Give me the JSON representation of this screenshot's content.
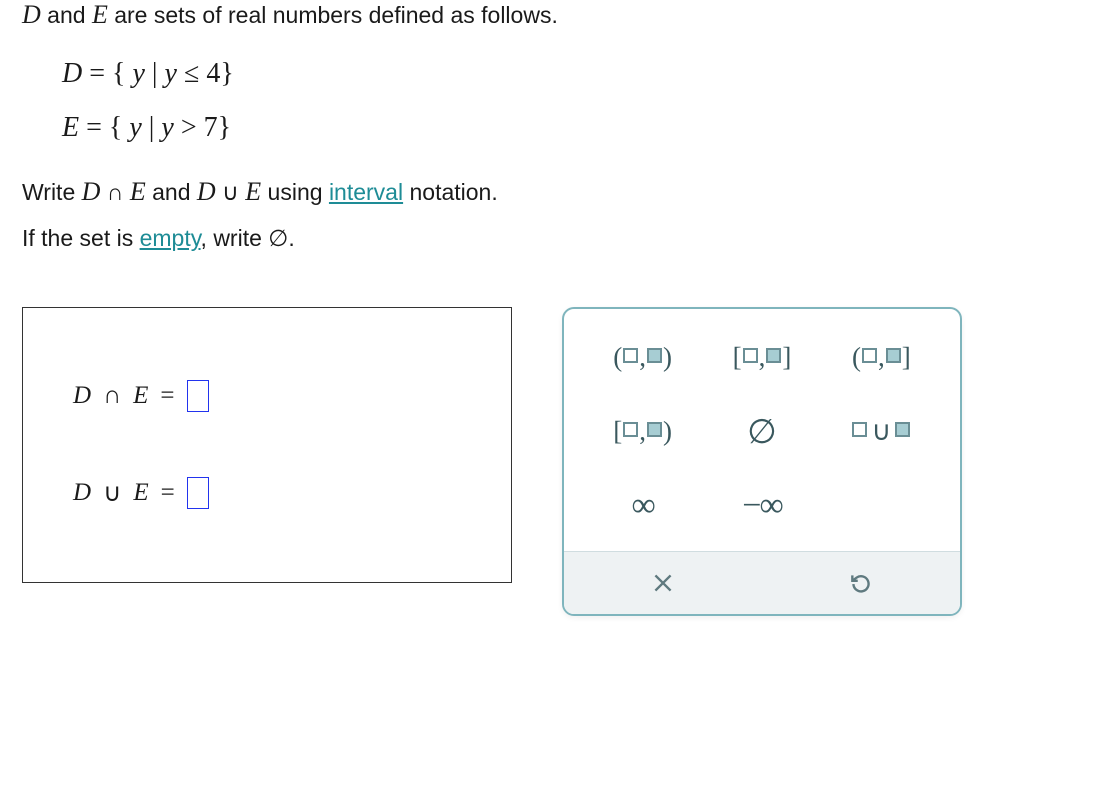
{
  "question": {
    "intro_pre": "D",
    "intro_mid": " and ",
    "intro_var2": "E",
    "intro_post": " are sets of real numbers defined as follows.",
    "defD": "D = { y | y ≤ 4 }",
    "defE": "E = { y | y > 7 }",
    "instr1_pre": "Write ",
    "instr1_cap": "D ∩ E",
    "instr1_mid": " and ",
    "instr1_cup": "D ∪ E",
    "instr1_post": " using ",
    "interval_link": "interval",
    "instr1_end": " notation.",
    "instr2_pre": "If the set is ",
    "empty_link": "empty",
    "instr2_mid": ", write ",
    "emptyset": "∅",
    "instr2_end": "."
  },
  "answers": {
    "row1_var1": "D",
    "row1_op": "∩",
    "row1_var2": "E",
    "row1_eq": "=",
    "row2_var1": "D",
    "row2_op": "∪",
    "row2_var2": "E",
    "row2_eq": "="
  },
  "pallette": {
    "open_open_l": "(",
    "open_open_r": ")",
    "closed_closed_l": "[",
    "closed_closed_r": "]",
    "open_closed_l": "(",
    "open_closed_r": "]",
    "closed_open_l": "[",
    "closed_open_r": ")",
    "comma": ",",
    "emptyset": "∅",
    "union_op": "∪",
    "infinity": "∞",
    "neg_infinity": "−∞"
  }
}
